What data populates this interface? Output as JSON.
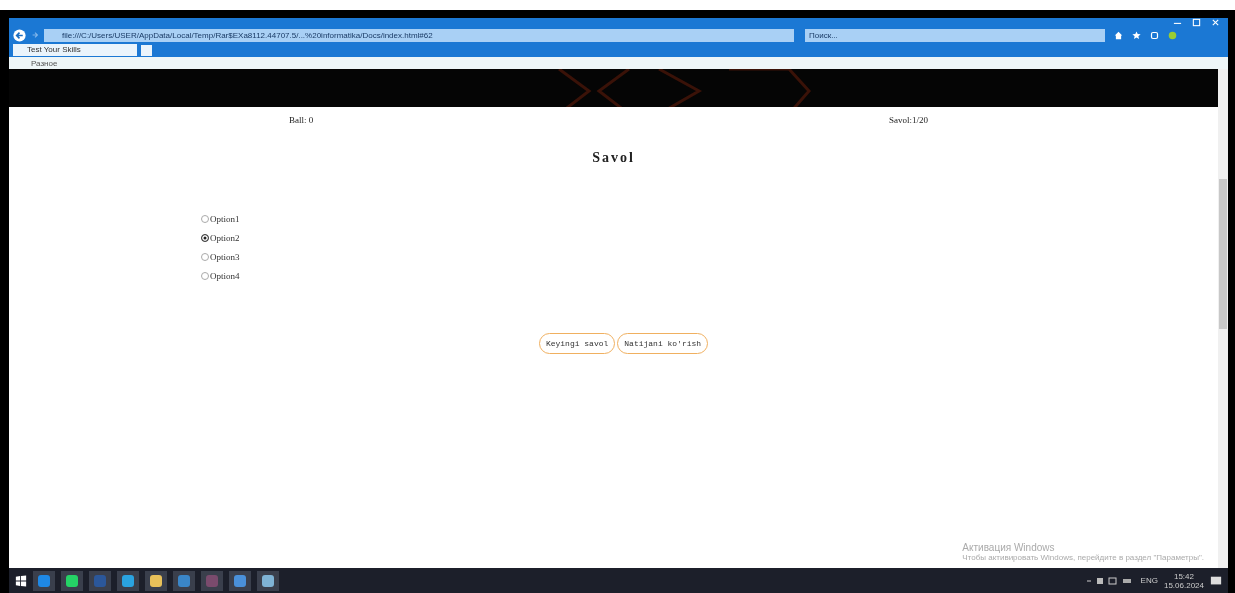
{
  "browser": {
    "url": "file:///C:/Users/USER/AppData/Local/Temp/Rar$EXa8112.44707.5/...%20informatika/Docs/index.html#62",
    "search": {
      "placeholder": "Поиск..."
    },
    "tab": {
      "title": "Test Your Skills"
    },
    "favorites": [
      {
        "label": "Разное"
      }
    ]
  },
  "quiz": {
    "score": "Ball: 0",
    "progress": "Savol:1/20",
    "title": "Savol",
    "options": [
      {
        "label": "Option1",
        "selected": false
      },
      {
        "label": "Option2",
        "selected": true
      },
      {
        "label": "Option3",
        "selected": false
      },
      {
        "label": "Option4",
        "selected": false
      }
    ],
    "buttons": [
      {
        "label": "Keyingi savol"
      },
      {
        "label": "Natijani ko'rish"
      }
    ]
  },
  "activation": {
    "title": "Активация Windows",
    "text": "Чтобы активировать Windows, перейдите в раздел \"Параметры\"."
  },
  "taskbar": {
    "language": "ENG",
    "time": "15:42",
    "date": "15.06.2024"
  }
}
